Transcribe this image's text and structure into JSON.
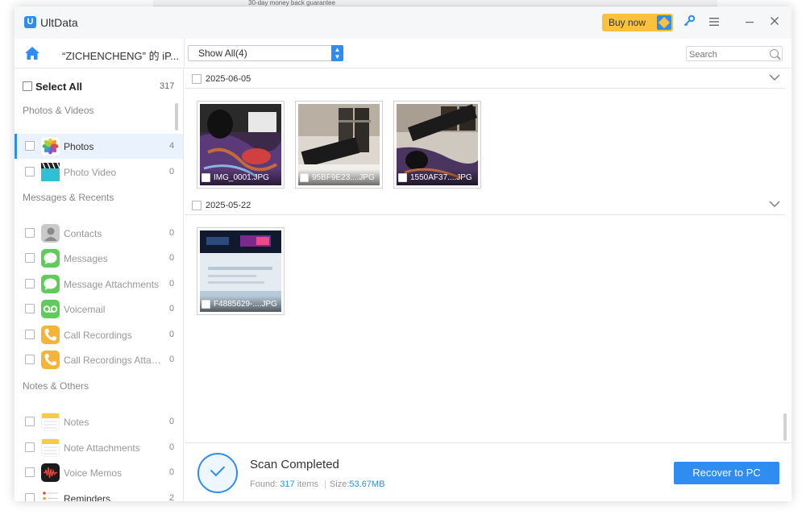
{
  "background": {
    "banner_text": "30-day money back guarantee"
  },
  "titlebar": {
    "app_name": "UltData",
    "logo_letter": "U",
    "buy_label": "Buy now",
    "icons": [
      "key-icon",
      "menu-icon",
      "minimize-icon",
      "close-icon"
    ]
  },
  "toolbar": {
    "device_name": "“ZICHENCHENG” 的 iP...",
    "filter_value": "Show All(4)",
    "search_placeholder": "Search"
  },
  "sidebar": {
    "select_all_label": "Select All",
    "select_all_count": "317",
    "categories": [
      {
        "title": "Photos & Videos",
        "items": [
          {
            "label": "Photos",
            "count": "4",
            "active": true,
            "icon": "photos-icon"
          },
          {
            "label": "Photo Video",
            "count": "0",
            "icon": "photo-video-icon"
          }
        ]
      },
      {
        "title": "Messages & Recents",
        "items": [
          {
            "label": "Contacts",
            "count": "0",
            "icon": "contacts-icon"
          },
          {
            "label": "Messages",
            "count": "0",
            "icon": "messages-icon"
          },
          {
            "label": "Message Attachments",
            "count": "0",
            "icon": "message-attachments-icon"
          },
          {
            "label": "Voicemail",
            "count": "0",
            "icon": "voicemail-icon"
          },
          {
            "label": "Call Recordings",
            "count": "0",
            "icon": "call-recordings-icon"
          },
          {
            "label": "Call Recordings Attach...",
            "count": "0",
            "icon": "call-recordings-attachments-icon"
          }
        ]
      },
      {
        "title": "Notes & Others",
        "items": [
          {
            "label": "Notes",
            "count": "0",
            "icon": "notes-icon"
          },
          {
            "label": "Note Attachments",
            "count": "0",
            "icon": "note-attachments-icon"
          },
          {
            "label": "Voice Memos",
            "count": "0",
            "icon": "voice-memos-icon"
          },
          {
            "label": "Reminders",
            "count": "2",
            "icon": "reminders-icon"
          }
        ]
      }
    ]
  },
  "groups": [
    {
      "date": "2025-06-05",
      "photos": [
        {
          "filename": "IMG_0001.JPG"
        },
        {
          "filename": "95BF9E23....JPG"
        },
        {
          "filename": "1550AF37....JPG"
        }
      ]
    },
    {
      "date": "2025-05-22",
      "photos": [
        {
          "filename": "F4885629-....JPG"
        }
      ]
    }
  ],
  "status": {
    "title": "Scan Completed",
    "found_label": "Found:",
    "found_count": "317",
    "found_unit": "items",
    "size_label": "Size:",
    "size_value": "53.67MB",
    "recover_label": "Recover to PC"
  },
  "colors": {
    "accent": "#2f8cf0",
    "buy_button": "#f9c23c",
    "active_row": "#eaf3fd"
  }
}
